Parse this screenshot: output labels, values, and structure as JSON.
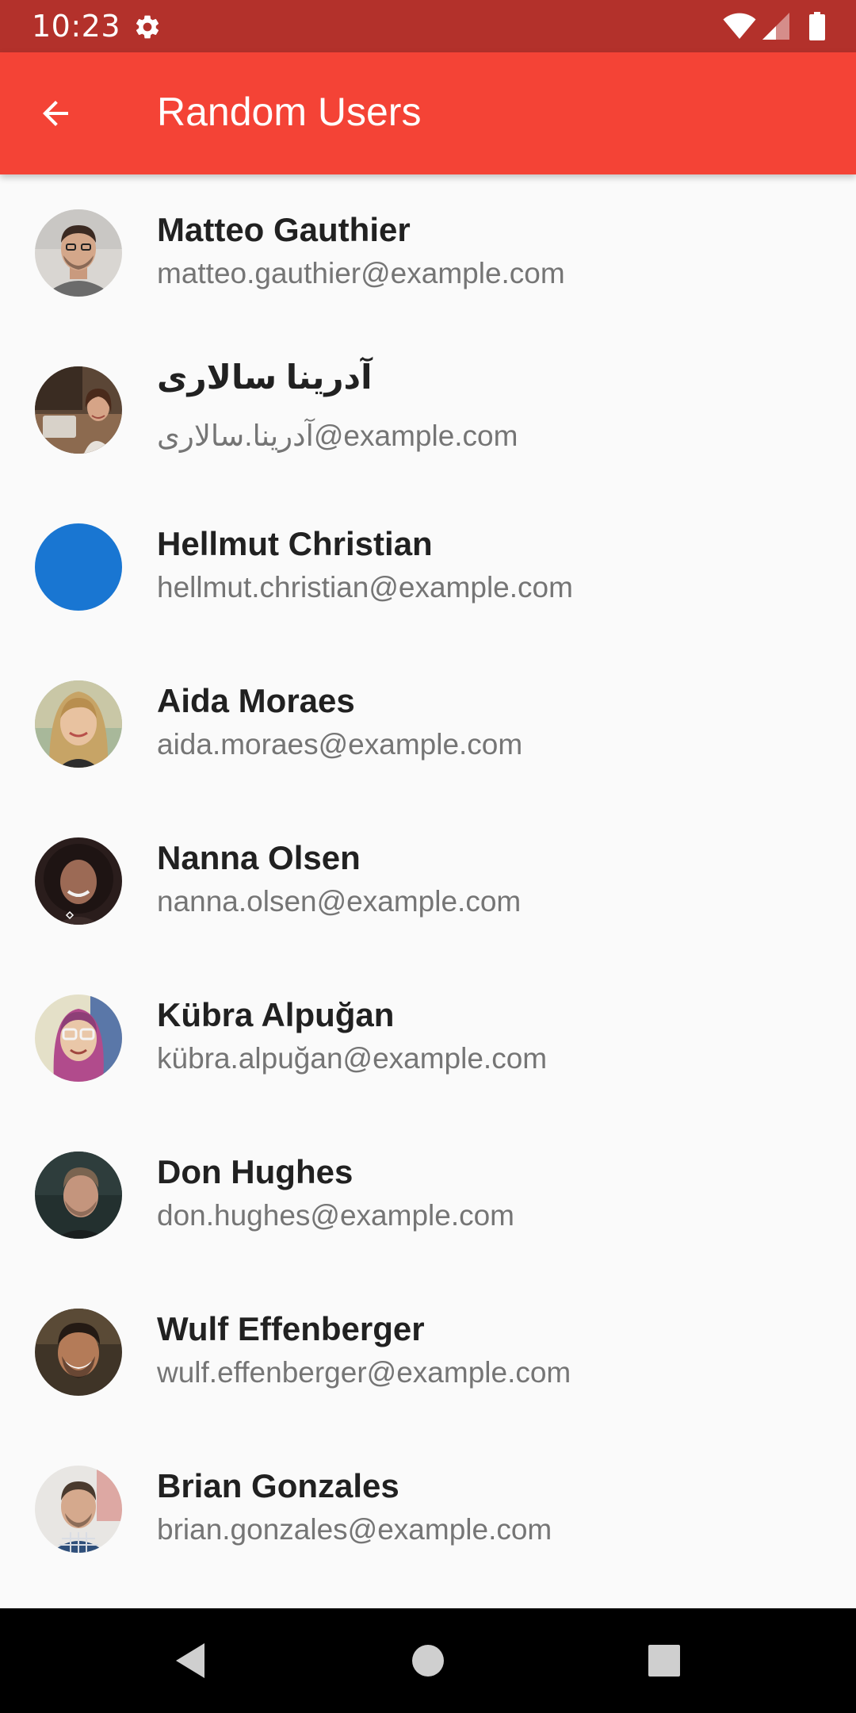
{
  "status_bar": {
    "time": "10:23",
    "background": "#b3312b",
    "icons": [
      "gear-icon",
      "wifi-icon",
      "signal-icon",
      "battery-icon"
    ]
  },
  "app_bar": {
    "title": "Random Users",
    "background": "#f44336",
    "back_icon": "arrow-back-icon"
  },
  "users": [
    {
      "name": "Matteo Gauthier",
      "email": "matteo.gauthier@example.com",
      "avatar": "photo"
    },
    {
      "name": "آدرینا سالاری",
      "email": "آدرینا.سالاری@example.com",
      "avatar": "photo"
    },
    {
      "name": "Hellmut Christian",
      "email": "hellmut.christian@example.com",
      "avatar": "solid-blue",
      "avatar_color": "#1976d2"
    },
    {
      "name": "Aida Moraes",
      "email": "aida.moraes@example.com",
      "avatar": "photo"
    },
    {
      "name": "Nanna Olsen",
      "email": "nanna.olsen@example.com",
      "avatar": "photo"
    },
    {
      "name": "Kübra Alpuğan",
      "email": "kübra.alpuğan@example.com",
      "avatar": "photo"
    },
    {
      "name": "Don Hughes",
      "email": "don.hughes@example.com",
      "avatar": "photo"
    },
    {
      "name": "Wulf Effenberger",
      "email": "wulf.effenberger@example.com",
      "avatar": "photo"
    },
    {
      "name": "Brian Gonzales",
      "email": "brian.gonzales@example.com",
      "avatar": "photo"
    }
  ],
  "nav_bar": {
    "icons": [
      "back-triangle-icon",
      "home-circle-icon",
      "recents-square-icon"
    ],
    "background": "#000000"
  }
}
